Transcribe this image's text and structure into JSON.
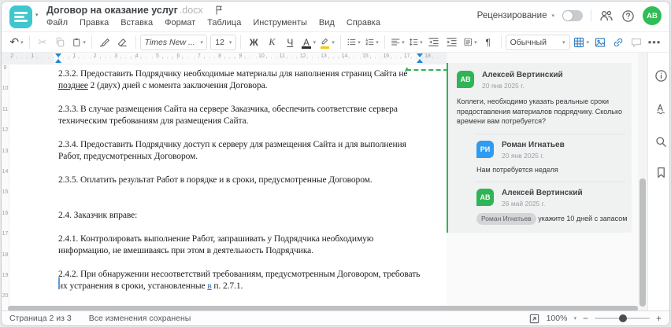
{
  "header": {
    "title": "Договор на оказание услуг",
    "title_ext": ".docx",
    "menu": [
      "Файл",
      "Правка",
      "Вставка",
      "Формат",
      "Таблица",
      "Инструменты",
      "Вид",
      "Справка"
    ],
    "review_label": "Рецензирование",
    "avatar_initials": "АВ"
  },
  "toolbar": {
    "undo": "↶",
    "cut": "✂",
    "font_family": "Times New ...",
    "font_size": "12",
    "bold": "Ж",
    "italic": "К",
    "underline": "Ч",
    "font_color": "А",
    "pilcrow": "¶",
    "style_name": "Обычный",
    "more": "•••"
  },
  "ruler": {
    "h_numbers": [
      "2",
      "1",
      "",
      "1",
      "2",
      "3",
      "4",
      "5",
      "6",
      "7",
      "8",
      "9",
      "10",
      "11",
      "12",
      "13",
      "14",
      "15",
      "16",
      "17",
      "18"
    ],
    "v_numbers": [
      "9",
      "10",
      "11",
      "12",
      "13",
      "14",
      "15",
      "16",
      "17",
      "18",
      "19",
      "20"
    ]
  },
  "document": {
    "p1_l1": "2.3.2. Предоставить Подрядчику необходимые материалы для наполнения страниц Сайта не",
    "p1_l2_ins": "позднее",
    "p1_l2_rest": " 2 (двух) дней с момента заключения Договора.",
    "p2_l1": "2.3.3. В случае размещения Сайта на сервере Заказчика, обеспечить соответствие сервера",
    "p2_l2": "техническим требованиям для размещения Сайта.",
    "p3_l1": "2.3.4. Предоставить Подрядчику доступ к серверу для размещения Сайта и для выполнения",
    "p3_l2": "Работ, предусмотренных Договором.",
    "p4": "2.3.5. Оплатить результат Работ в порядке и в сроки, предусмотренные Договором.",
    "p5": "2.4. Заказчик вправе:",
    "p6_l1": "2.4.1. Контролировать выполнение Работ, запрашивать у Подрядчика необходимую",
    "p6_l2": "информацию, не вмешиваясь при этом в деятельность Подрядчика.",
    "p7_l1": "2.4.2. При обнаружении несоответствий требованиям, предусмотренным Договором, требовать",
    "p7_l2_pre": "их устранения в сроки, установленные ",
    "p7_l2_ins": "в",
    "p7_l2_post": " п. 2.7.1."
  },
  "comments": {
    "thread": [
      {
        "initials": "АВ",
        "name": "Алексей Вертинский",
        "date": "20 янв 2025 г.",
        "text": "Коллеги, необходимо указать реальные сроки предоставления материалов подрядчику. Сколько времени вам потребуется?"
      },
      {
        "initials": "РИ",
        "name": "Роман Игнатьев",
        "date": "20 янв 2025 г.",
        "text": "Нам потребуется неделя"
      },
      {
        "initials": "АВ",
        "name": "Алексей Вертинский",
        "date": "26 май 2025 г.",
        "mention": "Роман Игнатьев",
        "text": "укажите 10 дней с запасом"
      }
    ]
  },
  "statusbar": {
    "page_label": "Страница 2 из 3",
    "saved_label": "Все изменения сохранены",
    "zoom_value": "100%"
  },
  "colors": {
    "accent_teal": "#3fc6ce",
    "comment_green": "#2fb456",
    "comment_blue": "#2f9bf1",
    "toolbar_blue": "#3b82c4"
  }
}
